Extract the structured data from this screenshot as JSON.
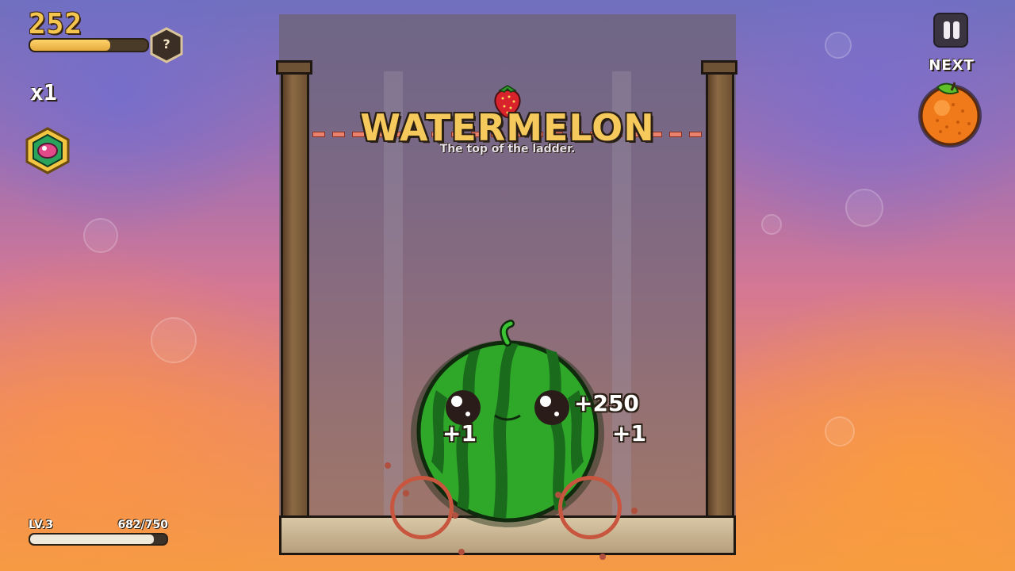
{
  "hud": {
    "score": "252",
    "score_progress": 0.68,
    "mystery_label": "?",
    "multiplier": "x1",
    "pause_icon": "pause-icon",
    "next_label": "NEXT",
    "next_fruit": "orange"
  },
  "banner": {
    "fruit_icon": "strawberry-icon",
    "title": "WATERMELON",
    "subtitle": "The top of the ladder."
  },
  "popups": {
    "big": "+250",
    "left": "+1",
    "right": "+1"
  },
  "level": {
    "label": "LV.3",
    "xp_text": "682/750",
    "progress": 0.909
  },
  "colors": {
    "score_gold": "#f5c64f",
    "deadline_red": "#e9826d",
    "watermelon_green": "#2fa82a"
  }
}
